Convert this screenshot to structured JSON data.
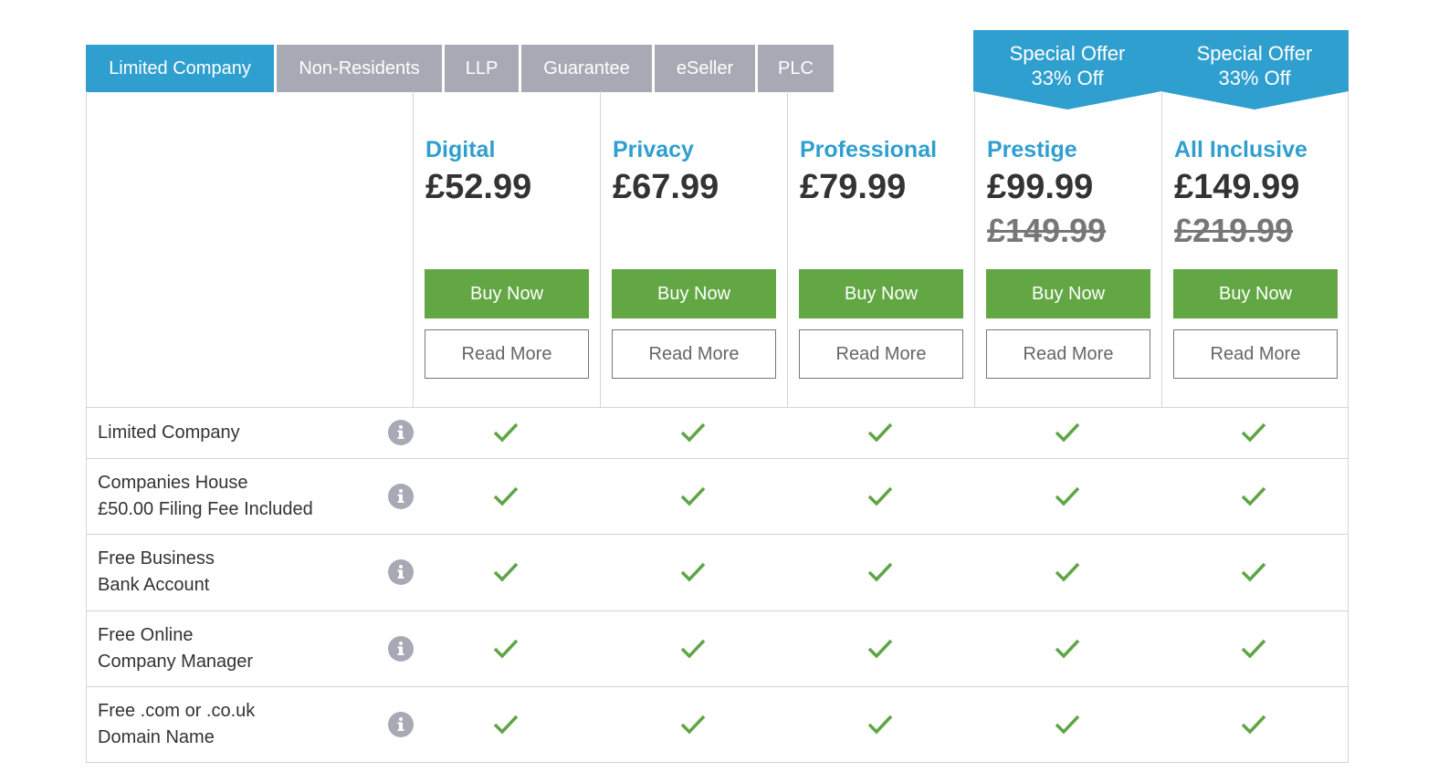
{
  "tabs": [
    {
      "label": "Limited Company",
      "active": true
    },
    {
      "label": "Non-Residents",
      "active": false
    },
    {
      "label": "LLP",
      "active": false
    },
    {
      "label": "Guarantee",
      "active": false
    },
    {
      "label": "eSeller",
      "active": false
    },
    {
      "label": "PLC",
      "active": false
    }
  ],
  "plans": [
    {
      "name": "Digital",
      "price": "£52.99",
      "buy_label": "Buy Now",
      "read_label": "Read More"
    },
    {
      "name": "Privacy",
      "price": "£67.99",
      "buy_label": "Buy Now",
      "read_label": "Read More"
    },
    {
      "name": "Professional",
      "price": "£79.99",
      "buy_label": "Buy Now",
      "read_label": "Read More"
    },
    {
      "name": "Prestige",
      "price": "£99.99",
      "old_price": "£149.99",
      "offer_line1": "Special Offer",
      "offer_line2": "33% Off",
      "buy_label": "Buy Now",
      "read_label": "Read More"
    },
    {
      "name": "All Inclusive",
      "price": "£149.99",
      "old_price": "£219.99",
      "offer_line1": "Special Offer",
      "offer_line2": "33% Off",
      "buy_label": "Buy Now",
      "read_label": "Read More"
    }
  ],
  "features": [
    {
      "line1": "Limited Company",
      "line2": ""
    },
    {
      "line1": "Companies House",
      "line2": "£50.00 Filing Fee Included"
    },
    {
      "line1": "Free Business",
      "line2": "Bank Account"
    },
    {
      "line1": "Free Online",
      "line2": "Company Manager"
    },
    {
      "line1": "Free .com or .co.uk",
      "line2": "Domain Name"
    }
  ],
  "colors": {
    "accent": "#2f9fcf",
    "tab_inactive": "#a7aab4",
    "buy_green": "#62a744",
    "check_green": "#5fa545"
  },
  "icons": {
    "info": "info-icon",
    "check": "check-icon"
  }
}
